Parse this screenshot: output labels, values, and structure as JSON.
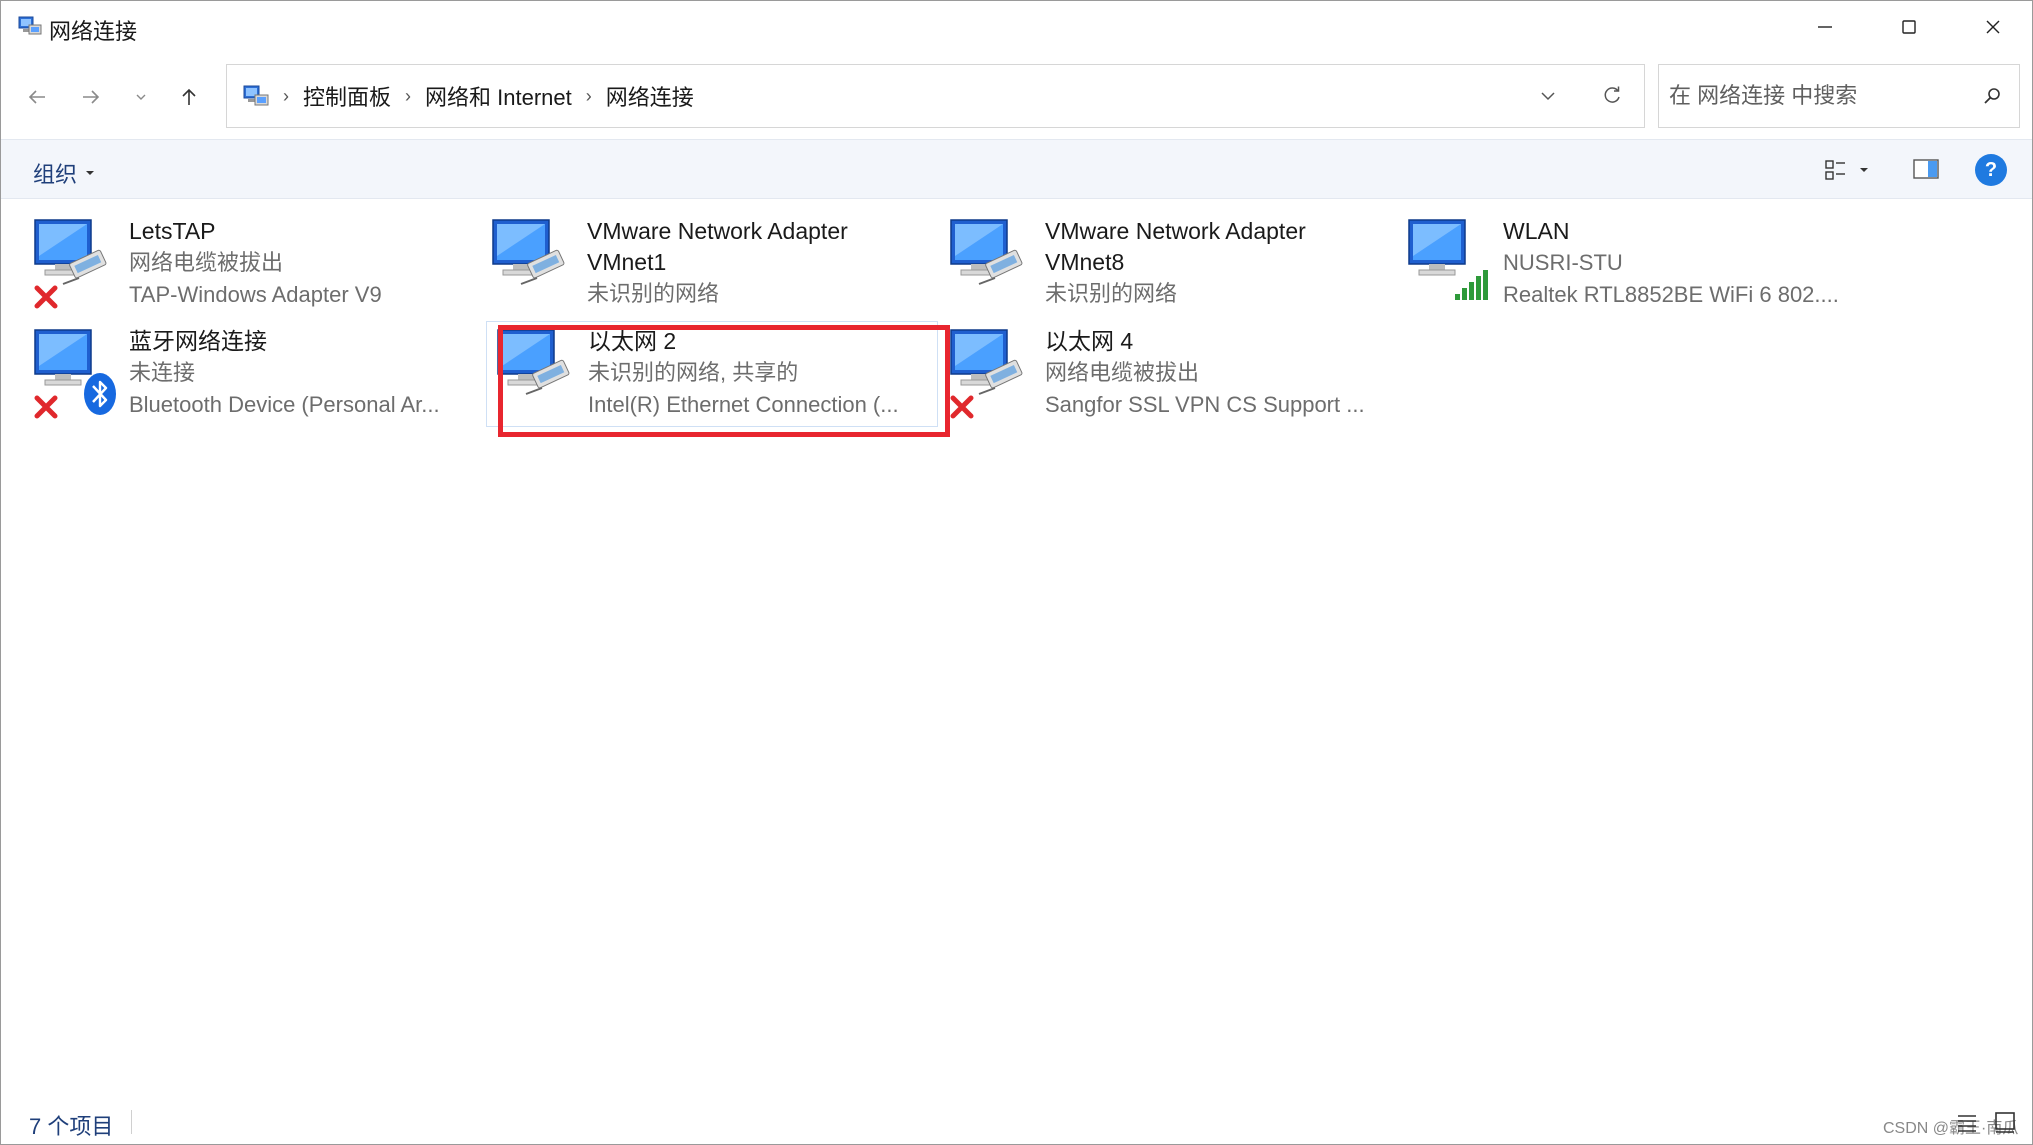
{
  "window": {
    "title": "网络连接",
    "minimize": "—",
    "maximize": "☐",
    "close": "✕"
  },
  "nav": {
    "back": "←",
    "forward": "→",
    "recent": "⌄",
    "up": "↑"
  },
  "breadcrumb": [
    "控制面板",
    "网络和 Internet",
    "网络连接"
  ],
  "breadcrumb_sep": "›",
  "search": {
    "placeholder": "在 网络连接 中搜索"
  },
  "commandbar": {
    "organize": "组织",
    "help": "?"
  },
  "connections": [
    {
      "name": "LetsTAP",
      "name2": "",
      "status": "网络电缆被拔出",
      "device": "TAP-Windows Adapter V9",
      "badge": "x-mark-icon",
      "type": "ethernet"
    },
    {
      "name": "VMware Network Adapter",
      "name2": "VMnet1",
      "status": "未识别的网络",
      "device": "",
      "badge": "",
      "type": "ethernet"
    },
    {
      "name": "VMware Network Adapter",
      "name2": "VMnet8",
      "status": "未识别的网络",
      "device": "",
      "badge": "",
      "type": "ethernet"
    },
    {
      "name": "WLAN",
      "name2": "",
      "status": "NUSRI-STU",
      "device": "Realtek RTL8852BE WiFi 6 802....",
      "badge": "",
      "type": "wifi"
    },
    {
      "name": "蓝牙网络连接",
      "name2": "",
      "status": "未连接",
      "device": "Bluetooth Device (Personal Ar...",
      "badge": "x-mark-icon",
      "type": "bluetooth"
    },
    {
      "name": "以太网 2",
      "name2": "",
      "status": "未识别的网络, 共享的",
      "device": "Intel(R) Ethernet Connection (...",
      "badge": "",
      "type": "ethernet"
    },
    {
      "name": "以太网 4",
      "name2": "",
      "status": "网络电缆被拔出",
      "device": "Sangfor SSL VPN CS Support ...",
      "badge": "x-mark-icon",
      "type": "ethernet"
    }
  ],
  "statusbar": {
    "count": "7 个项目",
    "watermark": "CSDN @霸王·南瓜"
  },
  "colors": {
    "accent": "#1f7ae0",
    "highlight": "#e8262f",
    "cmdbar_bg": "#f3f6fb",
    "link_text": "#1f3f7a",
    "secondary_text": "#6d6d6d"
  }
}
